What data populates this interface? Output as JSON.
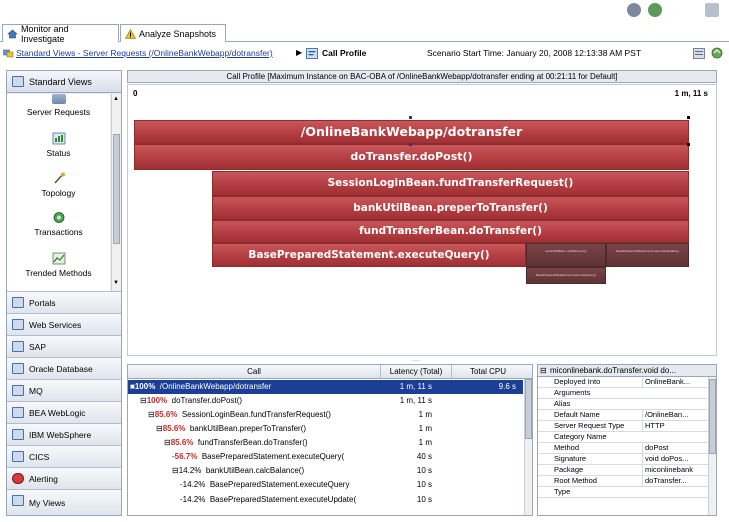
{
  "tabs": [
    {
      "label": "Monitor and Investigate",
      "icon": "home-icon"
    },
    {
      "label": "Analyze Snapshots",
      "icon": "warning-icon"
    }
  ],
  "breadcrumb": {
    "path": "Standard Views - Server Requests (/OnlineBankWebapp/dotransfer)",
    "current": "Call Profile",
    "scenario": "Scenario Start Time:  January 20, 2008 12:13:38 AM PST"
  },
  "sidebar": {
    "header": "Standard Views",
    "items": [
      {
        "label": "Server Requests",
        "icon": "server-requests-icon"
      },
      {
        "label": "Status",
        "icon": "status-icon"
      },
      {
        "label": "Topology",
        "icon": "topology-icon"
      },
      {
        "label": "Transactions",
        "icon": "transactions-icon"
      },
      {
        "label": "Trended Methods",
        "icon": "trended-methods-icon"
      }
    ],
    "sections": [
      "Portals",
      "Web Services",
      "SAP",
      "Oracle Database",
      "MQ",
      "BEA WebLogic",
      "IBM WebSphere",
      "CICS",
      "Alerting",
      "My Views"
    ]
  },
  "call_profile": {
    "title": "Call Profile [Maximum Instance on BAC-OBA of /OnlineBankWebapp/dotransfer ending at 00:21:11 for Default]",
    "axis_start": "0",
    "axis_end": "1 m, 11 s",
    "bars": [
      {
        "label": "/OnlineBankWebapp/dotransfer"
      },
      {
        "label": "doTransfer.doPost()"
      },
      {
        "label": "SessionLoginBean.fundTransferRequest()"
      },
      {
        "label": "bankUtilBean.preperToTransfer()"
      },
      {
        "label": "fundTransferBean.doTransfer()"
      },
      {
        "label": "BasePreparedStatement.executeQuery()"
      },
      {
        "label": "bankUtilBean.calcBalance()"
      },
      {
        "label": "BasePreparedStatement.executeUpdate()"
      },
      {
        "label": "BasePreparedStatement.executeQuery()"
      }
    ]
  },
  "call_table": {
    "columns": [
      "Call",
      "Latency (Total)",
      "Total CPU"
    ],
    "rows": [
      {
        "pct": "100%",
        "call": "/OnlineBankWebapp/dotransfer",
        "latency": "1 m, 11 s",
        "cpu": "9.6 s",
        "selected": true
      },
      {
        "pct": "100%",
        "call": "doTransfer.doPost()",
        "latency": "1 m, 11 s",
        "cpu": ""
      },
      {
        "pct": "85.6%",
        "call": "SessionLoginBean.fundTransferRequest()",
        "latency": "1 m",
        "cpu": ""
      },
      {
        "pct": "85.6%",
        "call": "bankUtilBean.preperToTransfer()",
        "latency": "1 m",
        "cpu": ""
      },
      {
        "pct": "85.6%",
        "call": "fundTransferBean.doTransfer()",
        "latency": "1 m",
        "cpu": ""
      },
      {
        "pct": "56.7%",
        "call": "BasePreparedStatement.executeQuery(",
        "latency": "40 s",
        "cpu": ""
      },
      {
        "pct": "14.2%",
        "call": "bankUtilBean.calcBalance()",
        "latency": "10 s",
        "cpu": ""
      },
      {
        "pct": "14.2%",
        "call": "BasePreparedStatement.executeQuery",
        "latency": "10 s",
        "cpu": ""
      },
      {
        "pct": "14.2%",
        "call": "BasePreparedStatement.executeUpdate(",
        "latency": "10 s",
        "cpu": ""
      }
    ]
  },
  "properties": {
    "title": "miconlinebank.doTransfer.void do...",
    "rows": [
      {
        "k": "Deployed Into",
        "v": "OnlineBank..."
      },
      {
        "k": "Arguments",
        "v": ""
      },
      {
        "k": "Alias",
        "v": ""
      },
      {
        "k": "Default Name",
        "v": "/OnlineBan..."
      },
      {
        "k": "Server Request Type",
        "v": "HTTP"
      },
      {
        "k": "Category Name",
        "v": ""
      },
      {
        "k": "Method",
        "v": "doPost"
      },
      {
        "k": "Signature",
        "v": "void doPos..."
      },
      {
        "k": "Package",
        "v": "miconlinebank"
      },
      {
        "k": "Root Method",
        "v": "doTransfer..."
      },
      {
        "k": "Type",
        "v": ""
      }
    ]
  },
  "colors": {
    "bar_red": "#b23c40",
    "bar_dark": "#5f3335",
    "selection": "#1c3f96",
    "link": "#1d3f9a"
  }
}
